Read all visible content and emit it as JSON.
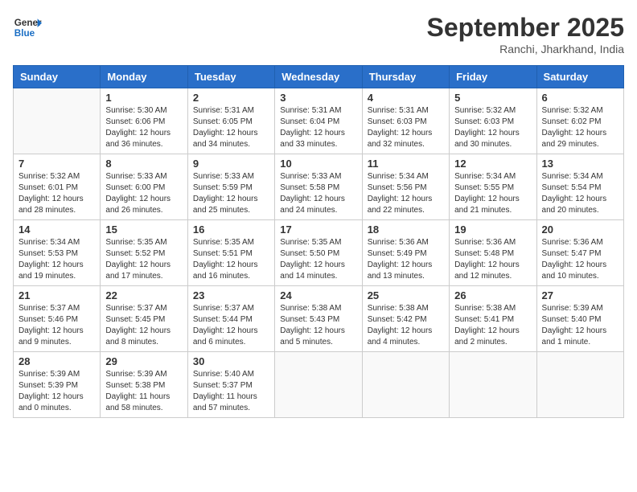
{
  "header": {
    "logo_general": "General",
    "logo_blue": "Blue",
    "month_title": "September 2025",
    "location": "Ranchi, Jharkhand, India"
  },
  "days_of_week": [
    "Sunday",
    "Monday",
    "Tuesday",
    "Wednesday",
    "Thursday",
    "Friday",
    "Saturday"
  ],
  "weeks": [
    [
      {
        "day": "",
        "content": ""
      },
      {
        "day": "1",
        "content": "Sunrise: 5:30 AM\nSunset: 6:06 PM\nDaylight: 12 hours\nand 36 minutes."
      },
      {
        "day": "2",
        "content": "Sunrise: 5:31 AM\nSunset: 6:05 PM\nDaylight: 12 hours\nand 34 minutes."
      },
      {
        "day": "3",
        "content": "Sunrise: 5:31 AM\nSunset: 6:04 PM\nDaylight: 12 hours\nand 33 minutes."
      },
      {
        "day": "4",
        "content": "Sunrise: 5:31 AM\nSunset: 6:03 PM\nDaylight: 12 hours\nand 32 minutes."
      },
      {
        "day": "5",
        "content": "Sunrise: 5:32 AM\nSunset: 6:03 PM\nDaylight: 12 hours\nand 30 minutes."
      },
      {
        "day": "6",
        "content": "Sunrise: 5:32 AM\nSunset: 6:02 PM\nDaylight: 12 hours\nand 29 minutes."
      }
    ],
    [
      {
        "day": "7",
        "content": "Sunrise: 5:32 AM\nSunset: 6:01 PM\nDaylight: 12 hours\nand 28 minutes."
      },
      {
        "day": "8",
        "content": "Sunrise: 5:33 AM\nSunset: 6:00 PM\nDaylight: 12 hours\nand 26 minutes."
      },
      {
        "day": "9",
        "content": "Sunrise: 5:33 AM\nSunset: 5:59 PM\nDaylight: 12 hours\nand 25 minutes."
      },
      {
        "day": "10",
        "content": "Sunrise: 5:33 AM\nSunset: 5:58 PM\nDaylight: 12 hours\nand 24 minutes."
      },
      {
        "day": "11",
        "content": "Sunrise: 5:34 AM\nSunset: 5:56 PM\nDaylight: 12 hours\nand 22 minutes."
      },
      {
        "day": "12",
        "content": "Sunrise: 5:34 AM\nSunset: 5:55 PM\nDaylight: 12 hours\nand 21 minutes."
      },
      {
        "day": "13",
        "content": "Sunrise: 5:34 AM\nSunset: 5:54 PM\nDaylight: 12 hours\nand 20 minutes."
      }
    ],
    [
      {
        "day": "14",
        "content": "Sunrise: 5:34 AM\nSunset: 5:53 PM\nDaylight: 12 hours\nand 19 minutes."
      },
      {
        "day": "15",
        "content": "Sunrise: 5:35 AM\nSunset: 5:52 PM\nDaylight: 12 hours\nand 17 minutes."
      },
      {
        "day": "16",
        "content": "Sunrise: 5:35 AM\nSunset: 5:51 PM\nDaylight: 12 hours\nand 16 minutes."
      },
      {
        "day": "17",
        "content": "Sunrise: 5:35 AM\nSunset: 5:50 PM\nDaylight: 12 hours\nand 14 minutes."
      },
      {
        "day": "18",
        "content": "Sunrise: 5:36 AM\nSunset: 5:49 PM\nDaylight: 12 hours\nand 13 minutes."
      },
      {
        "day": "19",
        "content": "Sunrise: 5:36 AM\nSunset: 5:48 PM\nDaylight: 12 hours\nand 12 minutes."
      },
      {
        "day": "20",
        "content": "Sunrise: 5:36 AM\nSunset: 5:47 PM\nDaylight: 12 hours\nand 10 minutes."
      }
    ],
    [
      {
        "day": "21",
        "content": "Sunrise: 5:37 AM\nSunset: 5:46 PM\nDaylight: 12 hours\nand 9 minutes."
      },
      {
        "day": "22",
        "content": "Sunrise: 5:37 AM\nSunset: 5:45 PM\nDaylight: 12 hours\nand 8 minutes."
      },
      {
        "day": "23",
        "content": "Sunrise: 5:37 AM\nSunset: 5:44 PM\nDaylight: 12 hours\nand 6 minutes."
      },
      {
        "day": "24",
        "content": "Sunrise: 5:38 AM\nSunset: 5:43 PM\nDaylight: 12 hours\nand 5 minutes."
      },
      {
        "day": "25",
        "content": "Sunrise: 5:38 AM\nSunset: 5:42 PM\nDaylight: 12 hours\nand 4 minutes."
      },
      {
        "day": "26",
        "content": "Sunrise: 5:38 AM\nSunset: 5:41 PM\nDaylight: 12 hours\nand 2 minutes."
      },
      {
        "day": "27",
        "content": "Sunrise: 5:39 AM\nSunset: 5:40 PM\nDaylight: 12 hours\nand 1 minute."
      }
    ],
    [
      {
        "day": "28",
        "content": "Sunrise: 5:39 AM\nSunset: 5:39 PM\nDaylight: 12 hours\nand 0 minutes."
      },
      {
        "day": "29",
        "content": "Sunrise: 5:39 AM\nSunset: 5:38 PM\nDaylight: 11 hours\nand 58 minutes."
      },
      {
        "day": "30",
        "content": "Sunrise: 5:40 AM\nSunset: 5:37 PM\nDaylight: 11 hours\nand 57 minutes."
      },
      {
        "day": "",
        "content": ""
      },
      {
        "day": "",
        "content": ""
      },
      {
        "day": "",
        "content": ""
      },
      {
        "day": "",
        "content": ""
      }
    ]
  ]
}
